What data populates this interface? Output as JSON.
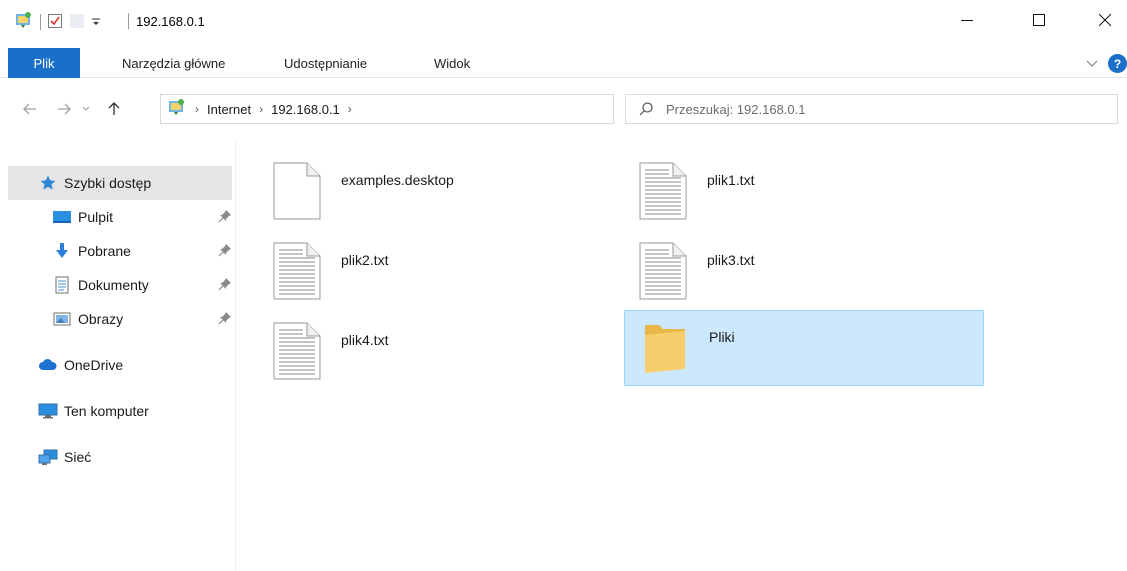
{
  "window": {
    "title": "192.168.0.1"
  },
  "ribbon": {
    "tabs": [
      "Plik",
      "Narzędzia główne",
      "Udostępnianie",
      "Widok"
    ],
    "help": "?"
  },
  "address": {
    "crumbs": [
      "Internet",
      "192.168.0.1"
    ]
  },
  "search": {
    "placeholder": "Przeszukaj: 192.168.0.1"
  },
  "sidebar": {
    "items": [
      {
        "label": "Szybki dostęp",
        "icon": "star-icon"
      },
      {
        "label": "Pulpit",
        "icon": "desktop-icon",
        "pinned": true
      },
      {
        "label": "Pobrane",
        "icon": "download-arrow-icon",
        "pinned": true
      },
      {
        "label": "Dokumenty",
        "icon": "documents-icon",
        "pinned": true
      },
      {
        "label": "Obrazy",
        "icon": "pictures-icon",
        "pinned": true
      },
      {
        "label": "OneDrive",
        "icon": "cloud-icon"
      },
      {
        "label": "Ten komputer",
        "icon": "computer-icon"
      },
      {
        "label": "Sieć",
        "icon": "network-icon"
      }
    ]
  },
  "files": [
    {
      "name": "examples.desktop",
      "type": "blank-file"
    },
    {
      "name": "plik1.txt",
      "type": "text-file"
    },
    {
      "name": "plik2.txt",
      "type": "text-file"
    },
    {
      "name": "plik3.txt",
      "type": "text-file"
    },
    {
      "name": "plik4.txt",
      "type": "text-file"
    },
    {
      "name": "Pliki",
      "type": "folder",
      "selected": true
    }
  ],
  "colors": {
    "accent": "#1a6fc9",
    "selection": "#cce8ff",
    "selection_border": "#99d1ff",
    "folder": "#f6cf6c"
  }
}
